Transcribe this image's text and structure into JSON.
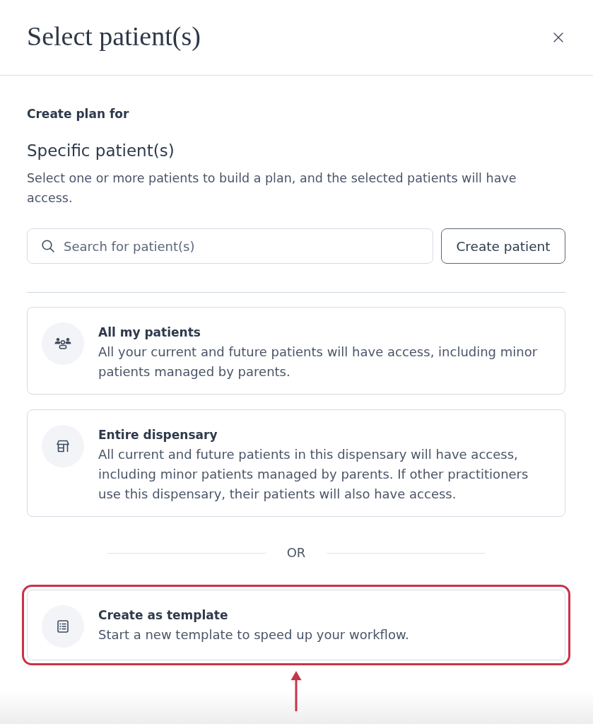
{
  "dialog": {
    "title": "Select patient(s)"
  },
  "plan": {
    "label": "Create plan for",
    "heading": "Specific patient(s)",
    "description": "Select one or more patients to build a plan, and the selected patients will have access.",
    "search": {
      "placeholder": "Search for patient(s)"
    },
    "create_button": "Create patient"
  },
  "options": [
    {
      "title": "All my patients",
      "description": "All your current and future patients will have access, including minor patients managed by parents.",
      "highlighted": false
    },
    {
      "title": "Entire dispensary",
      "description": "All current and future patients in this dispensary will have access, including minor patients managed by parents. If other practitioners use this dispensary, their patients will also have access.",
      "highlighted": false
    }
  ],
  "separator": "OR",
  "template_option": {
    "title": "Create as template",
    "description": "Start a new template to speed up your workflow.",
    "highlighted": true
  }
}
